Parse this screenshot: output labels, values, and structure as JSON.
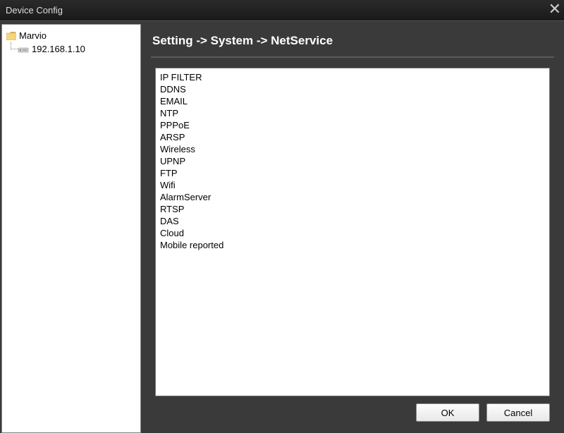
{
  "window": {
    "title": "Device Config"
  },
  "sidebar": {
    "root_label": "Marvio",
    "child_label": "192.168.1.10"
  },
  "breadcrumb": {
    "text": "Setting -> System -> NetService"
  },
  "services": {
    "items": [
      "IP FILTER",
      "DDNS",
      "EMAIL",
      "NTP",
      "PPPoE",
      "ARSP",
      "Wireless",
      "UPNP",
      "FTP",
      "Wifi",
      "AlarmServer",
      "RTSP",
      "DAS",
      "Cloud",
      "Mobile reported"
    ]
  },
  "buttons": {
    "ok": "OK",
    "cancel": "Cancel"
  }
}
